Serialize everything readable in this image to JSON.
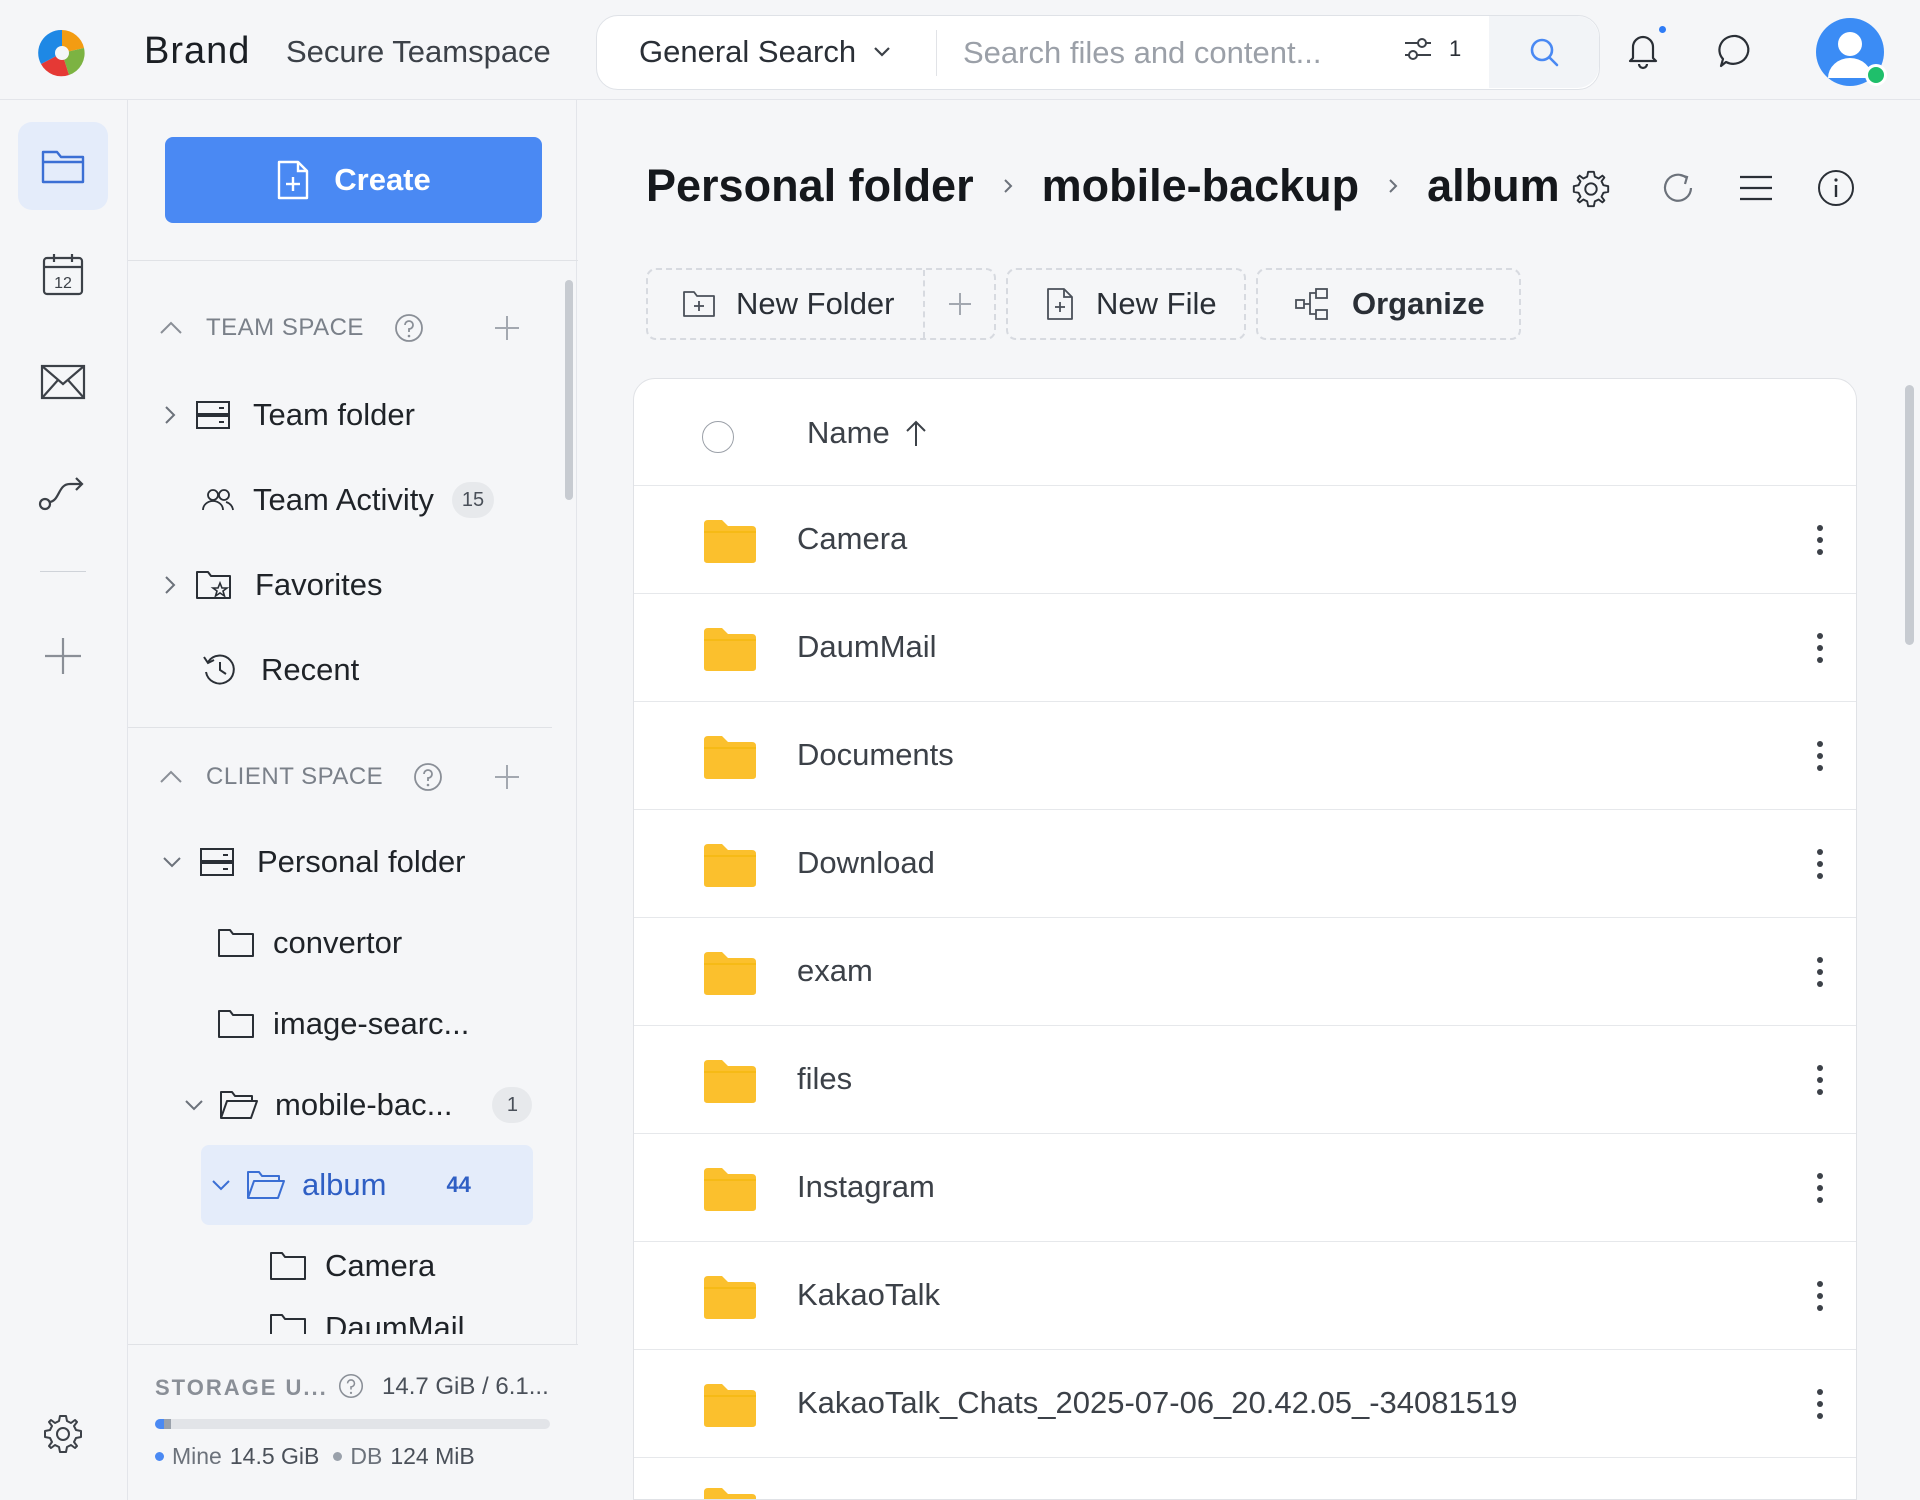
{
  "app": {
    "brand": "Brand",
    "workspace": "Secure Teamspace"
  },
  "search": {
    "scope": "General Search",
    "placeholder": "Search files and content...",
    "filter_count": "1"
  },
  "sidebar": {
    "create_label": "Create",
    "team_space": {
      "title": "TEAM SPACE",
      "items": [
        {
          "label": "Team folder",
          "icon": "server-icon"
        },
        {
          "label": "Team Activity",
          "icon": "people-icon",
          "badge": "15"
        },
        {
          "label": "Favorites",
          "icon": "star-folder-icon"
        },
        {
          "label": "Recent",
          "icon": "history-icon"
        }
      ]
    },
    "client_space": {
      "title": "CLIENT SPACE",
      "items": [
        {
          "label": "Personal folder"
        },
        {
          "label": "convertor"
        },
        {
          "label": "image-searc..."
        },
        {
          "label": "mobile-bac...",
          "badge": "1"
        },
        {
          "label": "album",
          "badge": "44"
        },
        {
          "label": "Camera"
        },
        {
          "label": "DaumMail"
        }
      ]
    },
    "storage": {
      "label": "STORAGE U...",
      "value": "14.7 GiB / 6.1...",
      "mine_label": "Mine",
      "mine_value": "14.5 GiB",
      "db_label": "DB",
      "db_value": "124 MiB",
      "mine_fraction": 0.024,
      "db_fraction": 0.016,
      "mine_color": "#4a89f3",
      "db_color": "#9aa1ab"
    }
  },
  "breadcrumb": [
    "Personal folder",
    "mobile-backup",
    "album"
  ],
  "toolbar": {
    "new_folder": "New Folder",
    "new_file": "New File",
    "organize": "Organize"
  },
  "list": {
    "column_name": "Name",
    "files": [
      "Camera",
      "DaumMail",
      "Documents",
      "Download",
      "exam",
      "files",
      "Instagram",
      "KakaoTalk",
      "KakaoTalk_Chats_2025-07-06_20.42.05_-34081519"
    ]
  },
  "colors": {
    "accent": "#4a89f3",
    "folder": "#fbc02d",
    "online": "#1fbf6b"
  }
}
